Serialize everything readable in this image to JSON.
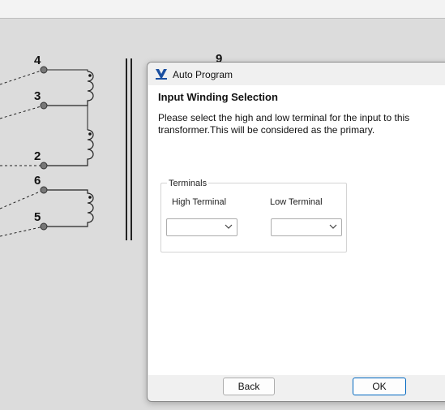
{
  "schematic": {
    "terminals": [
      "4",
      "3",
      "2",
      "6",
      "5"
    ],
    "partial_label": "9"
  },
  "dialog": {
    "title": "Auto Program",
    "heading": "Input Winding Selection",
    "description": "Please select the high and low terminal for the input to this transformer.This will be considered as the primary.",
    "terminals_group": {
      "legend": "Terminals",
      "high_label": "High Terminal",
      "low_label": "Low Terminal",
      "high_value": "",
      "low_value": ""
    },
    "buttons": {
      "back": "Back",
      "ok": "OK"
    }
  },
  "colors": {
    "accent": "#0067c0",
    "icon_blue": "#1a4fa0",
    "terminal_dot": "#666666"
  }
}
